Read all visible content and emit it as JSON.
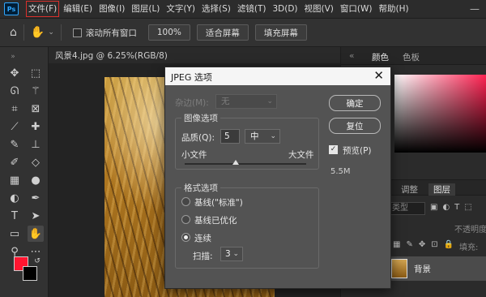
{
  "menubar": {
    "logo": "Ps",
    "items": [
      "文件(F)",
      "编辑(E)",
      "图像(I)",
      "图层(L)",
      "文字(Y)",
      "选择(S)",
      "滤镜(T)",
      "3D(D)",
      "视图(V)",
      "窗口(W)",
      "帮助(H)"
    ],
    "active_index": 0,
    "active_outline_color": "#d9302c"
  },
  "optionsbar": {
    "home_icon": "home-icon",
    "hand_icon": "hand-icon",
    "scroll_all_label": "滚动所有窗口",
    "zoom_100": "100%",
    "fit_screen": "适合屏幕",
    "fill_screen": "填充屏幕"
  },
  "toolbar": {
    "foreground_color": "#ff1530",
    "background_color": "#000000"
  },
  "document": {
    "tab_title": "风景4.jpg @ 6.25%(RGB/8)"
  },
  "right_panel": {
    "tabs": [
      "颜色",
      "色板"
    ],
    "layers_tabs": [
      "调整",
      "图层"
    ],
    "kind_label": "类型",
    "opacity_label": "不透明度:",
    "fill_label": "填充:",
    "layer_name": "背景"
  },
  "dialog": {
    "title": "JPEG 选项",
    "matte_label": "杂边(M):",
    "matte_value": "无",
    "image_options_legend": "图像选项",
    "quality_label": "品质(Q):",
    "quality_value": "5",
    "quality_level": "中",
    "quality_slider_fraction": 0.42,
    "small_file_label": "小文件",
    "large_file_label": "大文件",
    "format_options_legend": "格式选项",
    "radio_baseline": "基线(\"标准\")",
    "radio_baseline_optimized": "基线已优化",
    "radio_progressive": "连续",
    "selected_format": "连续",
    "scans_label": "扫描:",
    "scans_value": "3",
    "ok_button": "确定",
    "reset_button": "复位",
    "preview_label": "预览(P)",
    "preview_checked": true,
    "file_size": "5.5M"
  }
}
